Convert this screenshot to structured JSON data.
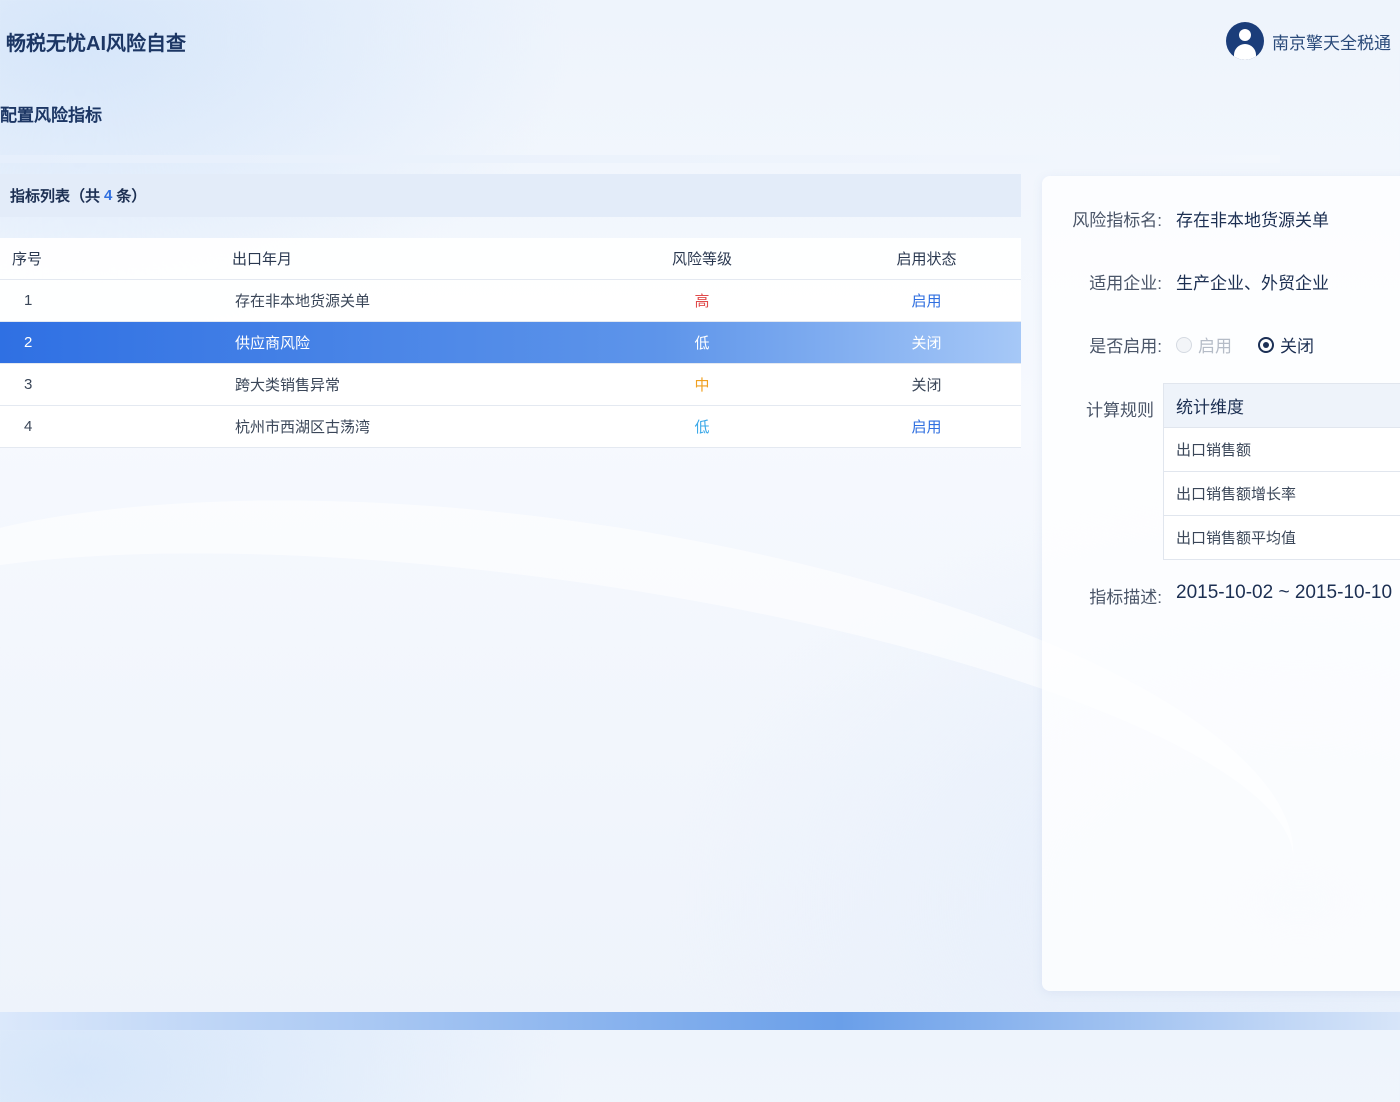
{
  "app": {
    "title": "畅税无忧AI风险自查"
  },
  "user": {
    "name": "南京擎天全税通"
  },
  "page": {
    "heading": "配置风险指标"
  },
  "list": {
    "title": "指标列表（共",
    "count": "4",
    "title_suffix": "条）",
    "columns": [
      "序号",
      "出口年月",
      "风险等级",
      "启用状态"
    ],
    "rows": [
      {
        "index": "1",
        "name": "存在非本地货源关单",
        "level": "高",
        "level_color": "#e04b4b",
        "state": "启用",
        "state_color": "#2f6fe0",
        "selected": false
      },
      {
        "index": "2",
        "name": "供应商风险",
        "level": "低",
        "level_color": "#ffffff",
        "state": "关闭",
        "state_color": "#ffffff",
        "selected": true
      },
      {
        "index": "3",
        "name": "跨大类销售异常",
        "level": "中",
        "level_color": "#f0a020",
        "state": "关闭",
        "state_color": "#3a4658",
        "selected": false
      },
      {
        "index": "4",
        "name": "杭州市西湖区古荡湾",
        "level": "低",
        "level_color": "#3aa8e8",
        "state": "启用",
        "state_color": "#2f6fe0",
        "selected": false
      }
    ]
  },
  "detail": {
    "name_label": "风险指标名:",
    "name_value": "存在非本地货源关单",
    "company_label": "适用企业:",
    "company_value": "生产企业、外贸企业",
    "enable_label": "是否启用:",
    "enable_on": "启用",
    "enable_off": "关闭",
    "enable_selected": "关闭",
    "rule_label": "计算规则",
    "rule_header": "统计维度",
    "rules": [
      "出口销售额",
      "出口销售额增长率",
      "出口销售额平均值"
    ],
    "desc_label": "指标描述:",
    "desc_value": "2015-10-02 ~ 2015-10-10"
  },
  "colors": {
    "accent": "#2f6fe0",
    "selected_row": "#3478e5",
    "title": "#1c3664"
  }
}
